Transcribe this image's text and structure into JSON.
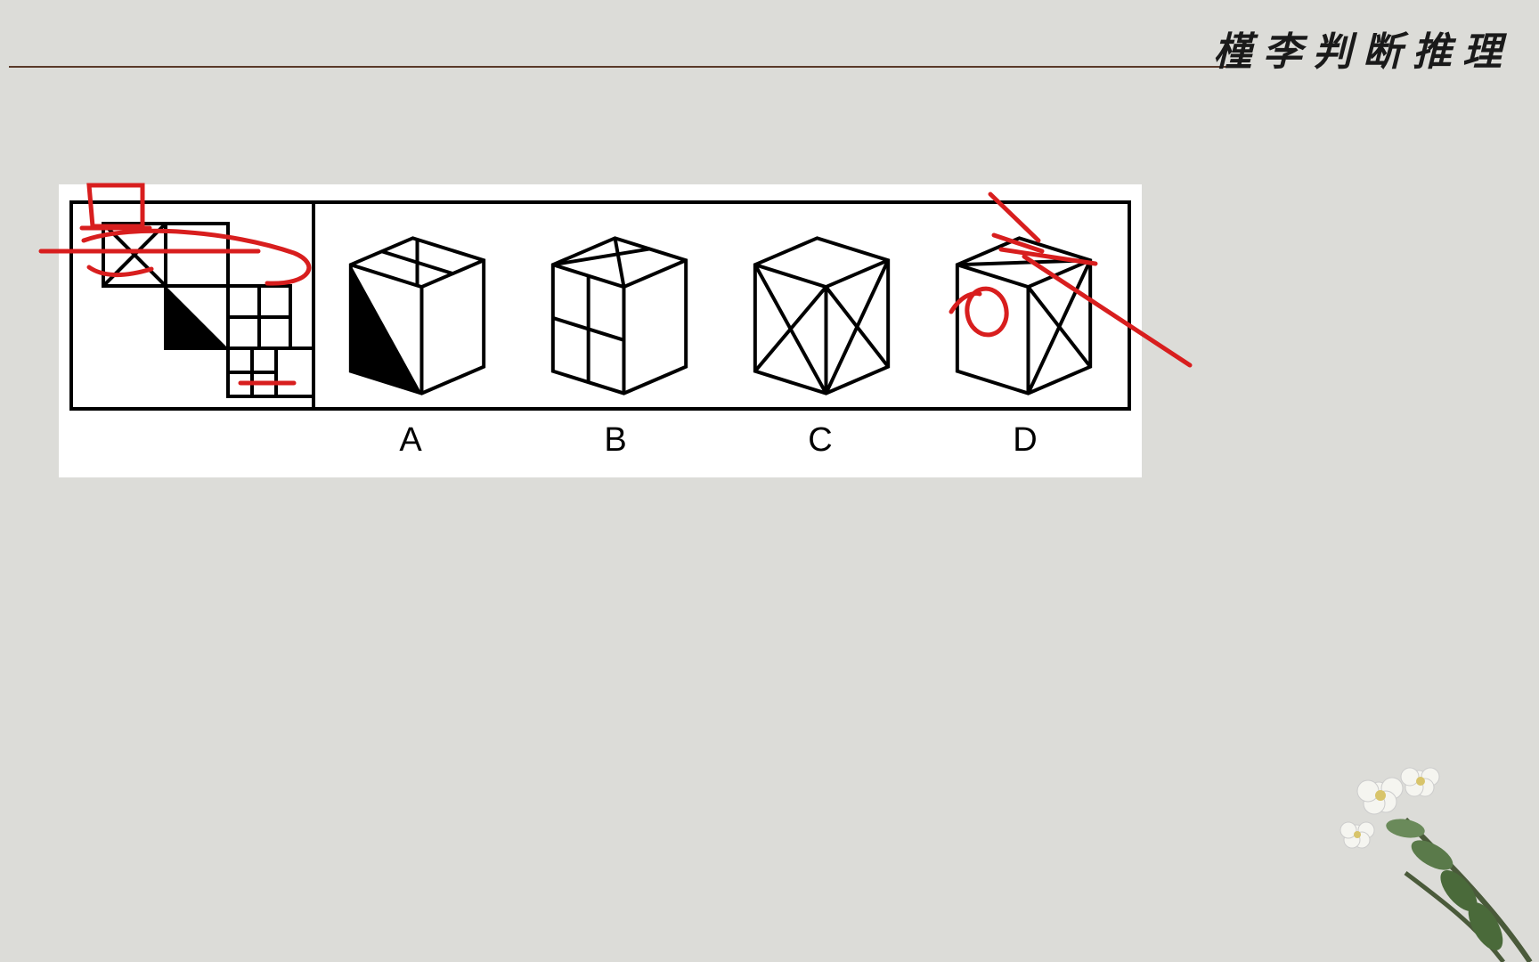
{
  "header": {
    "title": "槿李判断推理"
  },
  "question": {
    "options": [
      "A",
      "B",
      "C",
      "D"
    ],
    "answer_circle": "D"
  }
}
